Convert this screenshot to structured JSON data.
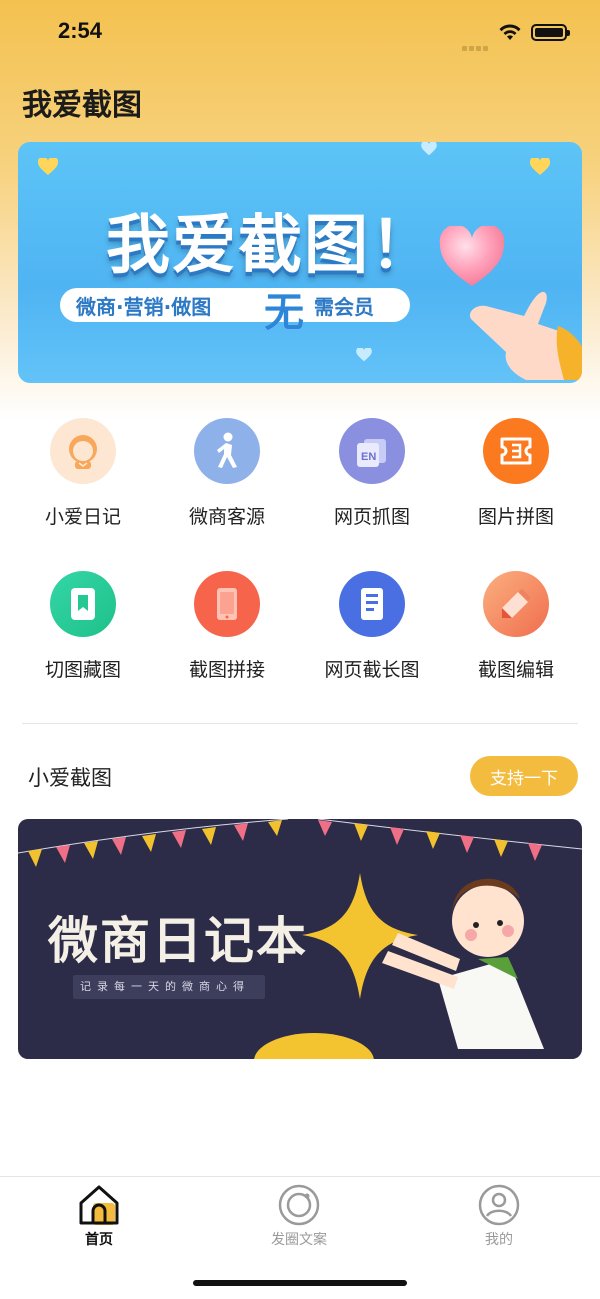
{
  "status_bar": {
    "time": "2:54"
  },
  "header": {
    "title": "我爱截图"
  },
  "banner": {
    "title": "我爱截图！",
    "tagline_left": "微商·营销·做图",
    "tagline_highlight": "无",
    "tagline_right": "需会员"
  },
  "tools": [
    {
      "label": "小爱日记",
      "icon": "avatar-icon",
      "color": "#fde7d3"
    },
    {
      "label": "微商客源",
      "icon": "walking-person-icon",
      "color": "#8fb1ea"
    },
    {
      "label": "网页抓图",
      "icon": "translate-en-icon",
      "color": "#8a8fe0"
    },
    {
      "label": "图片拼图",
      "icon": "ticket-icon",
      "color": "#fb7a1f"
    },
    {
      "label": "切图藏图",
      "icon": "bookmark-icon",
      "color": "#2fd1a0"
    },
    {
      "label": "截图拼接",
      "icon": "tablet-icon",
      "color": "#f6654b"
    },
    {
      "label": "网页截长图",
      "icon": "document-icon",
      "color": "#4a6fe3"
    },
    {
      "label": "截图编辑",
      "icon": "pencil-icon",
      "color": "#f8885d"
    }
  ],
  "section": {
    "title": "小爱截图",
    "support_button": "支持一下"
  },
  "promo_card": {
    "title": "微商日记本",
    "subtitle": "记录每一天的微商心得"
  },
  "tabbar": {
    "tabs": [
      {
        "label": "首页",
        "icon": "home-icon",
        "active": true
      },
      {
        "label": "发圈文案",
        "icon": "circle-icon",
        "active": false
      },
      {
        "label": "我的",
        "icon": "user-icon",
        "active": false
      }
    ]
  },
  "colors": {
    "accent": "#f3bc3f",
    "banner_blue": "#4fb4f2",
    "card_bg": "#2c2c49"
  }
}
